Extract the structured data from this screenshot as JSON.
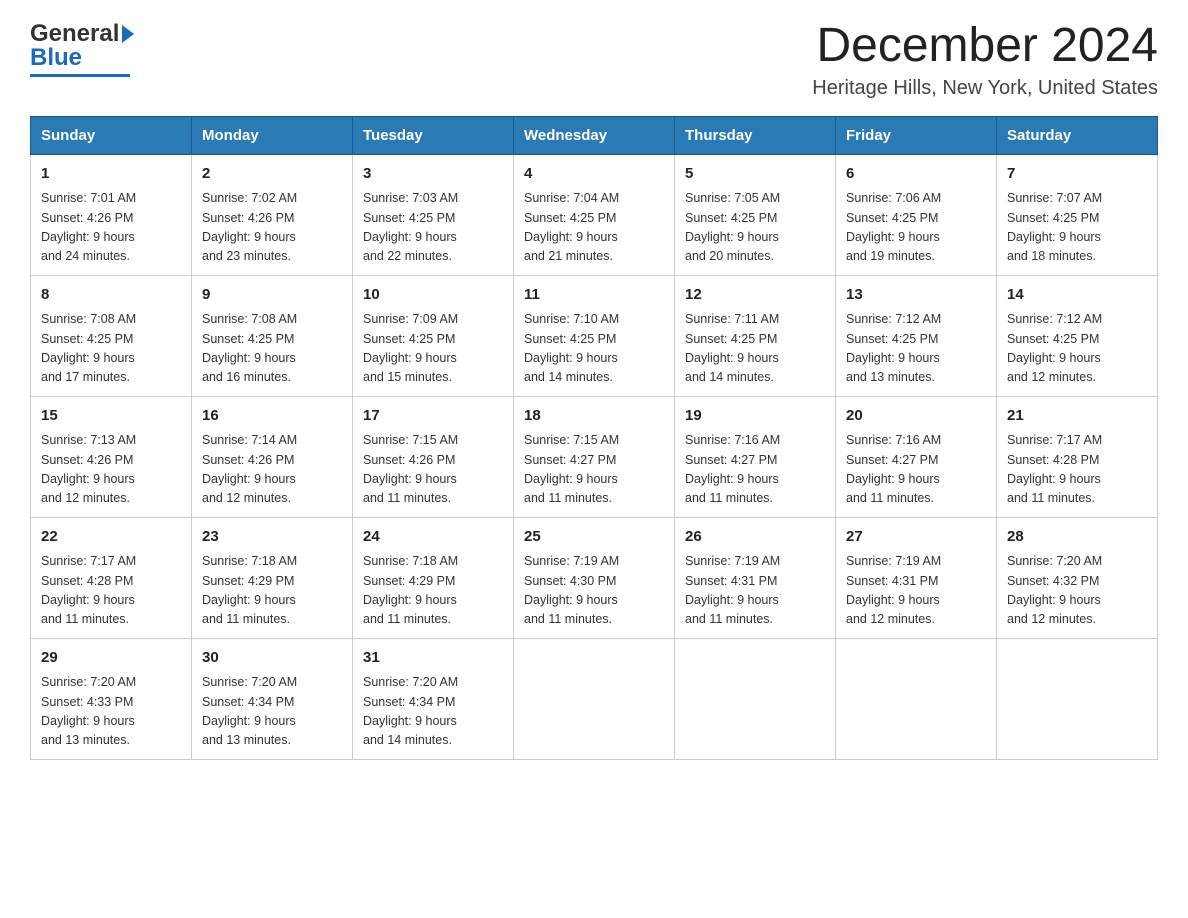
{
  "header": {
    "title": "December 2024",
    "subtitle": "Heritage Hills, New York, United States",
    "logo_general": "General",
    "logo_blue": "Blue"
  },
  "weekdays": [
    "Sunday",
    "Monday",
    "Tuesday",
    "Wednesday",
    "Thursday",
    "Friday",
    "Saturday"
  ],
  "weeks": [
    [
      {
        "day": 1,
        "sunrise": "7:01 AM",
        "sunset": "4:26 PM",
        "daylight": "9 hours and 24 minutes."
      },
      {
        "day": 2,
        "sunrise": "7:02 AM",
        "sunset": "4:26 PM",
        "daylight": "9 hours and 23 minutes."
      },
      {
        "day": 3,
        "sunrise": "7:03 AM",
        "sunset": "4:25 PM",
        "daylight": "9 hours and 22 minutes."
      },
      {
        "day": 4,
        "sunrise": "7:04 AM",
        "sunset": "4:25 PM",
        "daylight": "9 hours and 21 minutes."
      },
      {
        "day": 5,
        "sunrise": "7:05 AM",
        "sunset": "4:25 PM",
        "daylight": "9 hours and 20 minutes."
      },
      {
        "day": 6,
        "sunrise": "7:06 AM",
        "sunset": "4:25 PM",
        "daylight": "9 hours and 19 minutes."
      },
      {
        "day": 7,
        "sunrise": "7:07 AM",
        "sunset": "4:25 PM",
        "daylight": "9 hours and 18 minutes."
      }
    ],
    [
      {
        "day": 8,
        "sunrise": "7:08 AM",
        "sunset": "4:25 PM",
        "daylight": "9 hours and 17 minutes."
      },
      {
        "day": 9,
        "sunrise": "7:08 AM",
        "sunset": "4:25 PM",
        "daylight": "9 hours and 16 minutes."
      },
      {
        "day": 10,
        "sunrise": "7:09 AM",
        "sunset": "4:25 PM",
        "daylight": "9 hours and 15 minutes."
      },
      {
        "day": 11,
        "sunrise": "7:10 AM",
        "sunset": "4:25 PM",
        "daylight": "9 hours and 14 minutes."
      },
      {
        "day": 12,
        "sunrise": "7:11 AM",
        "sunset": "4:25 PM",
        "daylight": "9 hours and 14 minutes."
      },
      {
        "day": 13,
        "sunrise": "7:12 AM",
        "sunset": "4:25 PM",
        "daylight": "9 hours and 13 minutes."
      },
      {
        "day": 14,
        "sunrise": "7:12 AM",
        "sunset": "4:25 PM",
        "daylight": "9 hours and 12 minutes."
      }
    ],
    [
      {
        "day": 15,
        "sunrise": "7:13 AM",
        "sunset": "4:26 PM",
        "daylight": "9 hours and 12 minutes."
      },
      {
        "day": 16,
        "sunrise": "7:14 AM",
        "sunset": "4:26 PM",
        "daylight": "9 hours and 12 minutes."
      },
      {
        "day": 17,
        "sunrise": "7:15 AM",
        "sunset": "4:26 PM",
        "daylight": "9 hours and 11 minutes."
      },
      {
        "day": 18,
        "sunrise": "7:15 AM",
        "sunset": "4:27 PM",
        "daylight": "9 hours and 11 minutes."
      },
      {
        "day": 19,
        "sunrise": "7:16 AM",
        "sunset": "4:27 PM",
        "daylight": "9 hours and 11 minutes."
      },
      {
        "day": 20,
        "sunrise": "7:16 AM",
        "sunset": "4:27 PM",
        "daylight": "9 hours and 11 minutes."
      },
      {
        "day": 21,
        "sunrise": "7:17 AM",
        "sunset": "4:28 PM",
        "daylight": "9 hours and 11 minutes."
      }
    ],
    [
      {
        "day": 22,
        "sunrise": "7:17 AM",
        "sunset": "4:28 PM",
        "daylight": "9 hours and 11 minutes."
      },
      {
        "day": 23,
        "sunrise": "7:18 AM",
        "sunset": "4:29 PM",
        "daylight": "9 hours and 11 minutes."
      },
      {
        "day": 24,
        "sunrise": "7:18 AM",
        "sunset": "4:29 PM",
        "daylight": "9 hours and 11 minutes."
      },
      {
        "day": 25,
        "sunrise": "7:19 AM",
        "sunset": "4:30 PM",
        "daylight": "9 hours and 11 minutes."
      },
      {
        "day": 26,
        "sunrise": "7:19 AM",
        "sunset": "4:31 PM",
        "daylight": "9 hours and 11 minutes."
      },
      {
        "day": 27,
        "sunrise": "7:19 AM",
        "sunset": "4:31 PM",
        "daylight": "9 hours and 12 minutes."
      },
      {
        "day": 28,
        "sunrise": "7:20 AM",
        "sunset": "4:32 PM",
        "daylight": "9 hours and 12 minutes."
      }
    ],
    [
      {
        "day": 29,
        "sunrise": "7:20 AM",
        "sunset": "4:33 PM",
        "daylight": "9 hours and 13 minutes."
      },
      {
        "day": 30,
        "sunrise": "7:20 AM",
        "sunset": "4:34 PM",
        "daylight": "9 hours and 13 minutes."
      },
      {
        "day": 31,
        "sunrise": "7:20 AM",
        "sunset": "4:34 PM",
        "daylight": "9 hours and 14 minutes."
      },
      null,
      null,
      null,
      null
    ]
  ],
  "labels": {
    "sunrise": "Sunrise:",
    "sunset": "Sunset:",
    "daylight": "Daylight:"
  }
}
